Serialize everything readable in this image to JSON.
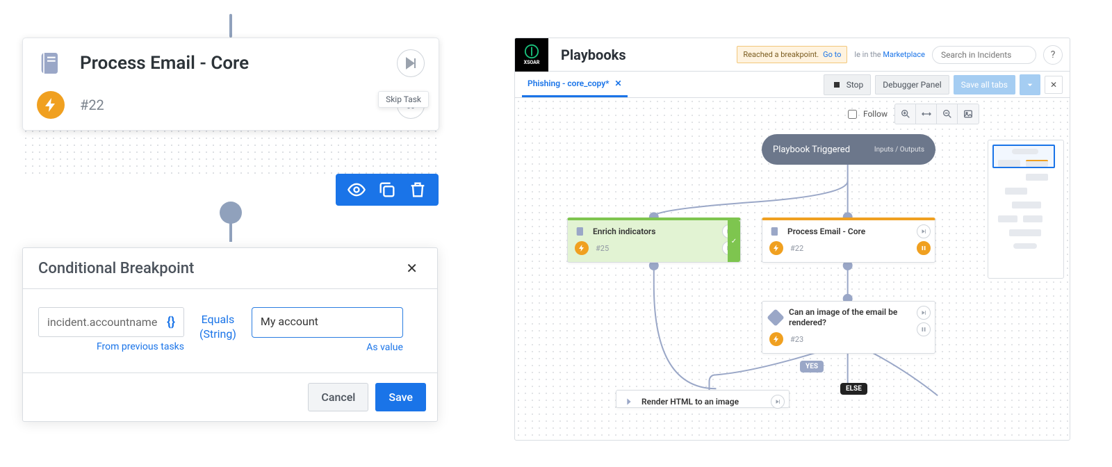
{
  "task_card": {
    "title": "Process Email - Core",
    "id": "#22",
    "tooltip_skip": "Skip Task"
  },
  "modal": {
    "title": "Conditional Breakpoint",
    "field_value": "incident.accountname",
    "from_previous": "From previous tasks",
    "operator_line1": "Equals",
    "operator_line2": "(String)",
    "value": "My account",
    "as_value": "As value",
    "cancel": "Cancel",
    "save": "Save"
  },
  "app": {
    "logo_text": "XSOAR",
    "title": "Playbooks",
    "banner_text": "Reached a breakpoint.",
    "banner_link": "Go to",
    "marketplace_prefix": "le in the",
    "marketplace_link": "Marketplace",
    "search_placeholder": "Search in Incidents",
    "help": "?",
    "tab_label": "Phishing - core_copy*",
    "stop": "Stop",
    "debugger_panel": "Debugger Panel",
    "save_all": "Save all tabs",
    "follow": "Follow",
    "start_node_label": "Playbook Triggered",
    "start_node_io": "Inputs / Outputs",
    "nodes": {
      "enrich": {
        "title": "Enrich indicators",
        "id": "#25"
      },
      "process": {
        "title": "Process Email - Core",
        "id": "#22"
      },
      "render_q": {
        "title": "Can an image of the email be rendered?",
        "id": "#23"
      },
      "render_html": {
        "title": "Render HTML to an image"
      }
    },
    "branches": {
      "yes": "YES",
      "else": "ELSE"
    }
  }
}
